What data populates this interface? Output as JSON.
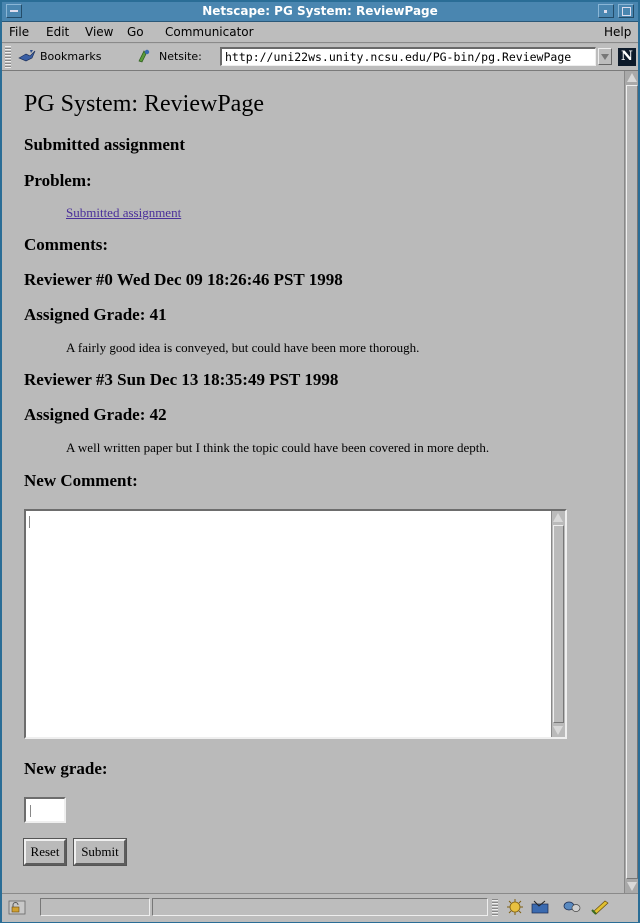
{
  "window": {
    "title": "Netscape: PG System: ReviewPage"
  },
  "menubar": {
    "items": [
      "File",
      "Edit",
      "View",
      "Go",
      "Communicator"
    ],
    "help": "Help"
  },
  "toolbar": {
    "bookmarks_label": "Bookmarks",
    "netsite_label": "Netsite:",
    "url": "http://uni22ws.unity.ncsu.edu/PG-bin/pg.ReviewPage"
  },
  "page": {
    "title": "PG System: ReviewPage",
    "heading": "Submitted assignment",
    "problem_label": "Problem:",
    "problem_link": "Submitted assignment",
    "comments_label": "Comments:",
    "reviews": [
      {
        "header": "Reviewer #0 Wed Dec 09 18:26:46 PST 1998",
        "grade": "Assigned Grade: 41",
        "comment": "A fairly good idea is conveyed, but could have been more thorough."
      },
      {
        "header": "Reviewer #3 Sun Dec 13 18:35:49 PST 1998",
        "grade": "Assigned Grade: 42",
        "comment": "A well written paper but I think the topic could have been covered in more depth."
      }
    ],
    "new_comment_label": "New Comment:",
    "new_comment_value": "",
    "new_grade_label": "New grade:",
    "new_grade_value": "",
    "reset_label": "Reset",
    "submit_label": "Submit"
  },
  "colors": {
    "title_bar": "#4a86b0",
    "chrome": "#bdbdbd",
    "content_bg": "#bababa",
    "link": "#4a2f9a"
  }
}
